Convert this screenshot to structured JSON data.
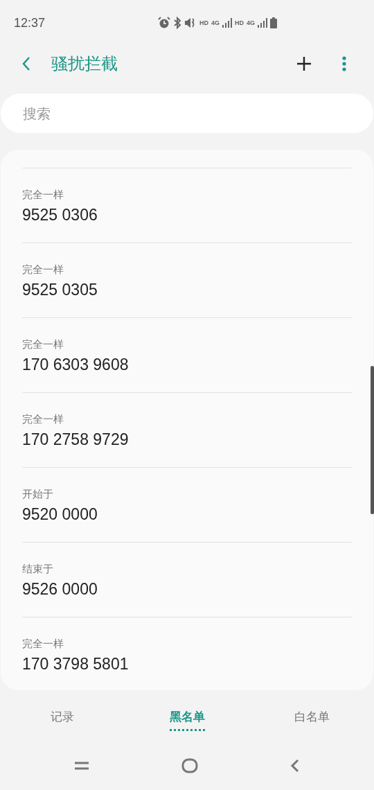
{
  "status_bar": {
    "time": "12:37",
    "indicators": [
      "HD",
      "4G",
      "HD",
      "4G"
    ]
  },
  "header": {
    "title": "骚扰拦截"
  },
  "search": {
    "placeholder": "搜索"
  },
  "blocked_numbers": [
    {
      "rule": "完全一样",
      "number": "9525 0306"
    },
    {
      "rule": "完全一样",
      "number": "9525 0305"
    },
    {
      "rule": "完全一样",
      "number": "170 6303 9608"
    },
    {
      "rule": "完全一样",
      "number": "170 2758 9729"
    },
    {
      "rule": "开始于",
      "number": "9520 0000"
    },
    {
      "rule": "结束于",
      "number": "9526 0000"
    },
    {
      "rule": "完全一样",
      "number": "170 3798 5801"
    }
  ],
  "tabs": [
    {
      "label": "记录",
      "selected": false
    },
    {
      "label": "黑名单",
      "selected": true
    },
    {
      "label": "白名单",
      "selected": false
    }
  ]
}
